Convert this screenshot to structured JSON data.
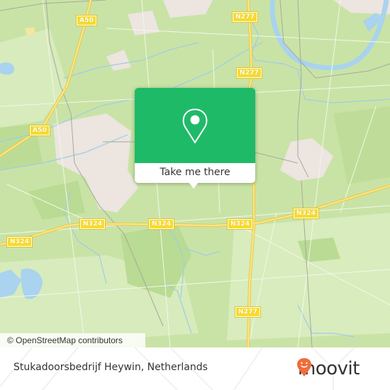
{
  "map": {
    "road_labels": [
      {
        "id": "a50-north",
        "text": "A50"
      },
      {
        "id": "a50-west",
        "text": "A50"
      },
      {
        "id": "n277-north",
        "text": "N277"
      },
      {
        "id": "n277-mid",
        "text": "N277"
      },
      {
        "id": "n277-south",
        "text": "N277"
      },
      {
        "id": "n324-far-west",
        "text": "N324"
      },
      {
        "id": "n324-west",
        "text": "N324"
      },
      {
        "id": "n324-center",
        "text": "N324"
      },
      {
        "id": "n324-mid-east",
        "text": "N324"
      },
      {
        "id": "n324-east",
        "text": "N324"
      }
    ],
    "attribution": "© OpenStreetMap contributors",
    "colors": {
      "land": "#c9e3a6",
      "forest": "#b5d98c",
      "urban": "#ece5e0",
      "water": "#a9d3ee",
      "major_road": "#f7dc5a"
    }
  },
  "popup": {
    "icon": "location-pin-icon",
    "cta_label": "Take me there",
    "accent_color": "#1fba68"
  },
  "footer": {
    "place_name": "Stukadoorsbedrijf Heywin, Netherlands",
    "brand": "moovit",
    "brand_color": "#f06d3c"
  }
}
